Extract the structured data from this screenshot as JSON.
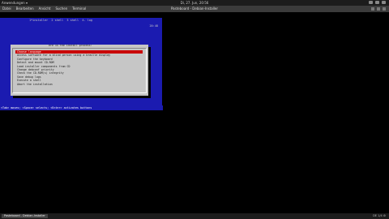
{
  "topbar": {
    "app_menu": "Anwendungen ▾",
    "date_time": "Di, 27. Jun, 20:56"
  },
  "window": {
    "menu": [
      "Terminal",
      "Datei",
      "Bearbeiten",
      "Ansicht",
      "Suchen",
      "Terminal",
      "Hilfe"
    ],
    "title": "Pasteboard - Debian-Installer"
  },
  "installer": {
    "tabs": "1*installer  2 shell  3 shell  4- log",
    "clock": "20:48",
    "dialog_header": "ere is the install process:",
    "items": [
      "Choose language",
      "Access software for a blind person using a braille display",
      "Configure the keyboard",
      "Detect and mount CD-ROM",
      "Load installer components from CD",
      "Change debconf priority",
      "Check the CD-ROM(s) integrity",
      "Save debug logs",
      "Execute a shell",
      "Abort the installation"
    ],
    "hint": "<Tab> moves; <Space> selects; <Enter> activates buttons"
  },
  "taskbar": {
    "task_label": "Pasteboard - Debian-Installer",
    "tray": "DE  1/4  ⚙"
  }
}
